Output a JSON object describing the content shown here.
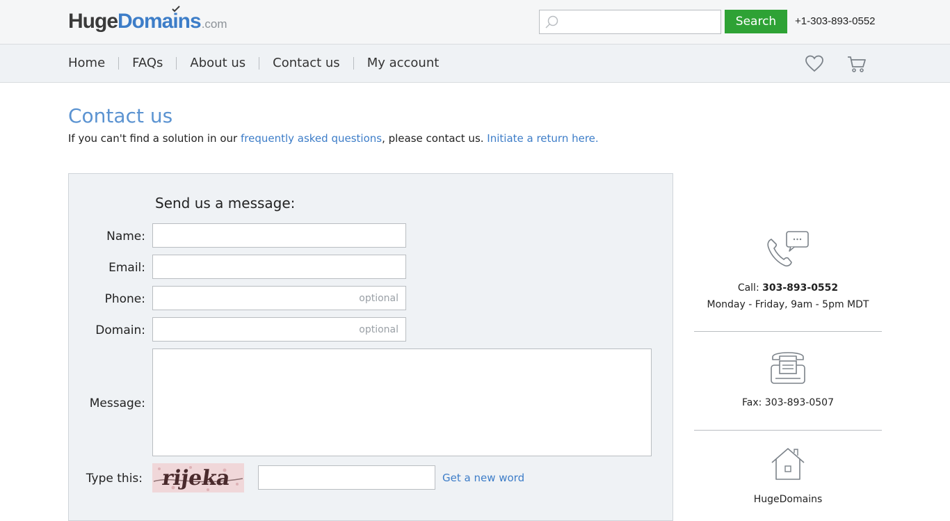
{
  "header": {
    "logo": {
      "huge": "Huge",
      "domains": "Domains",
      "dotcom": ".com"
    },
    "search": {
      "placeholder": "",
      "button_label": "Search"
    },
    "phone": "+1-303-893-0552"
  },
  "nav": {
    "items": [
      {
        "label": "Home"
      },
      {
        "label": "FAQs"
      },
      {
        "label": "About us"
      },
      {
        "label": "Contact us"
      },
      {
        "label": "My account"
      }
    ],
    "icons": [
      "heart-icon",
      "cart-icon"
    ]
  },
  "page": {
    "title": "Contact us",
    "intro_prefix": "If you can't find a solution in our ",
    "faq_link": "frequently asked questions",
    "intro_middle": ", please contact us. ",
    "return_link": "Initiate a return here."
  },
  "form": {
    "heading": "Send us a message:",
    "name_label": "Name:",
    "email_label": "Email:",
    "phone_label": "Phone:",
    "phone_placeholder": "optional",
    "domain_label": "Domain:",
    "domain_placeholder": "optional",
    "message_label": "Message:",
    "captcha_label": "Type this:",
    "captcha_word": "rijeka",
    "new_word_link": "Get a new word"
  },
  "contact": {
    "call_prefix": "Call: ",
    "call_number": "303-893-0552",
    "hours": "Monday - Friday, 9am - 5pm MDT",
    "fax": "Fax: 303-893-0507",
    "company": "HugeDomains"
  },
  "colors": {
    "accent_blue": "#3d7dc8",
    "search_green": "#2ea235"
  }
}
